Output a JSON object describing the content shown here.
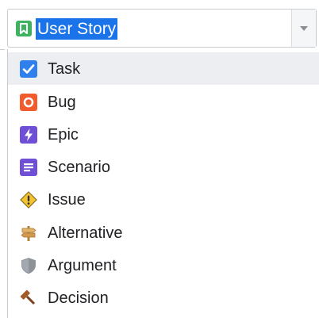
{
  "select": {
    "value": "User Story",
    "icon": "bookmark-icon",
    "icon_color": "#3db35f",
    "selection_color": "#1a73e8"
  },
  "options": [
    {
      "label": "Task",
      "icon": "checkbox-icon",
      "color": "#2f80ed",
      "highlighted": true
    },
    {
      "label": "Bug",
      "icon": "bug-icon",
      "color": "#f25c2c",
      "highlighted": false
    },
    {
      "label": "Epic",
      "icon": "lightning-icon",
      "color": "#6f4fd6",
      "highlighted": false
    },
    {
      "label": "Scenario",
      "icon": "document-icon",
      "color": "#6f4fd6",
      "highlighted": false
    },
    {
      "label": "Issue",
      "icon": "warning-icon",
      "color": "#f4c430",
      "highlighted": false
    },
    {
      "label": "Alternative",
      "icon": "signpost-icon",
      "color": "#d8a55a",
      "highlighted": false
    },
    {
      "label": "Argument",
      "icon": "shield-icon",
      "color": "#9aa0a6",
      "highlighted": false
    },
    {
      "label": "Decision",
      "icon": "gavel-icon",
      "color": "#b06a3b",
      "highlighted": false
    }
  ]
}
